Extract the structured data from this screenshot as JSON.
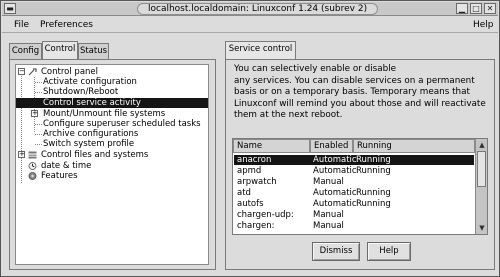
{
  "window": {
    "title": "localhost.localdomain: Linuxconf 1.24 (subrev 2)"
  },
  "menubar": {
    "file": "File",
    "preferences": "Preferences",
    "help": "Help"
  },
  "left_tabs": [
    {
      "label": "Config",
      "active": false
    },
    {
      "label": "Control",
      "active": true
    },
    {
      "label": "Status",
      "active": false
    }
  ],
  "tree": {
    "control_panel": "Control panel",
    "items": [
      "Activate configuration",
      "Shutdown/Reboot",
      "Control service activity",
      "Mount/Unmount file systems",
      "Configure superuser scheduled tasks",
      "Archive configurations",
      "Switch system profile"
    ],
    "selected": "Control service activity",
    "control_files": "Control files and systems",
    "date_time": "date & time",
    "features": "Features"
  },
  "right_tab": {
    "label": "Service control"
  },
  "description": {
    "line1": "You can selectively enable or disable",
    "line2": "any services. You can disable services on a permanent",
    "line3": "basis or on a temporary basis. Temporary means that",
    "line4": "Linuxconf will remind you about those and will reactivate",
    "line5": "them at the next reboot."
  },
  "services": {
    "headers": [
      "Name",
      "Enabled",
      "Running"
    ],
    "rows": [
      {
        "name": "anacron",
        "enabled": "Automatic",
        "running": "Running"
      },
      {
        "name": "apmd",
        "enabled": "Automatic",
        "running": "Running"
      },
      {
        "name": "arpwatch",
        "enabled": "Manual",
        "running": ""
      },
      {
        "name": "atd",
        "enabled": "Automatic",
        "running": "Running"
      },
      {
        "name": "autofs",
        "enabled": "Automatic",
        "running": "Running"
      },
      {
        "name": "chargen-udp:",
        "enabled": "Manual",
        "running": ""
      },
      {
        "name": "chargen:",
        "enabled": "Manual",
        "running": ""
      }
    ],
    "selected": "anacron"
  },
  "buttons": {
    "dismiss": "Dismiss",
    "help": "Help"
  },
  "icons": {
    "close": "close-icon",
    "maximize": "maximize-icon",
    "iconify": "iconify-icon",
    "title_menu": "window-menu-icon"
  }
}
